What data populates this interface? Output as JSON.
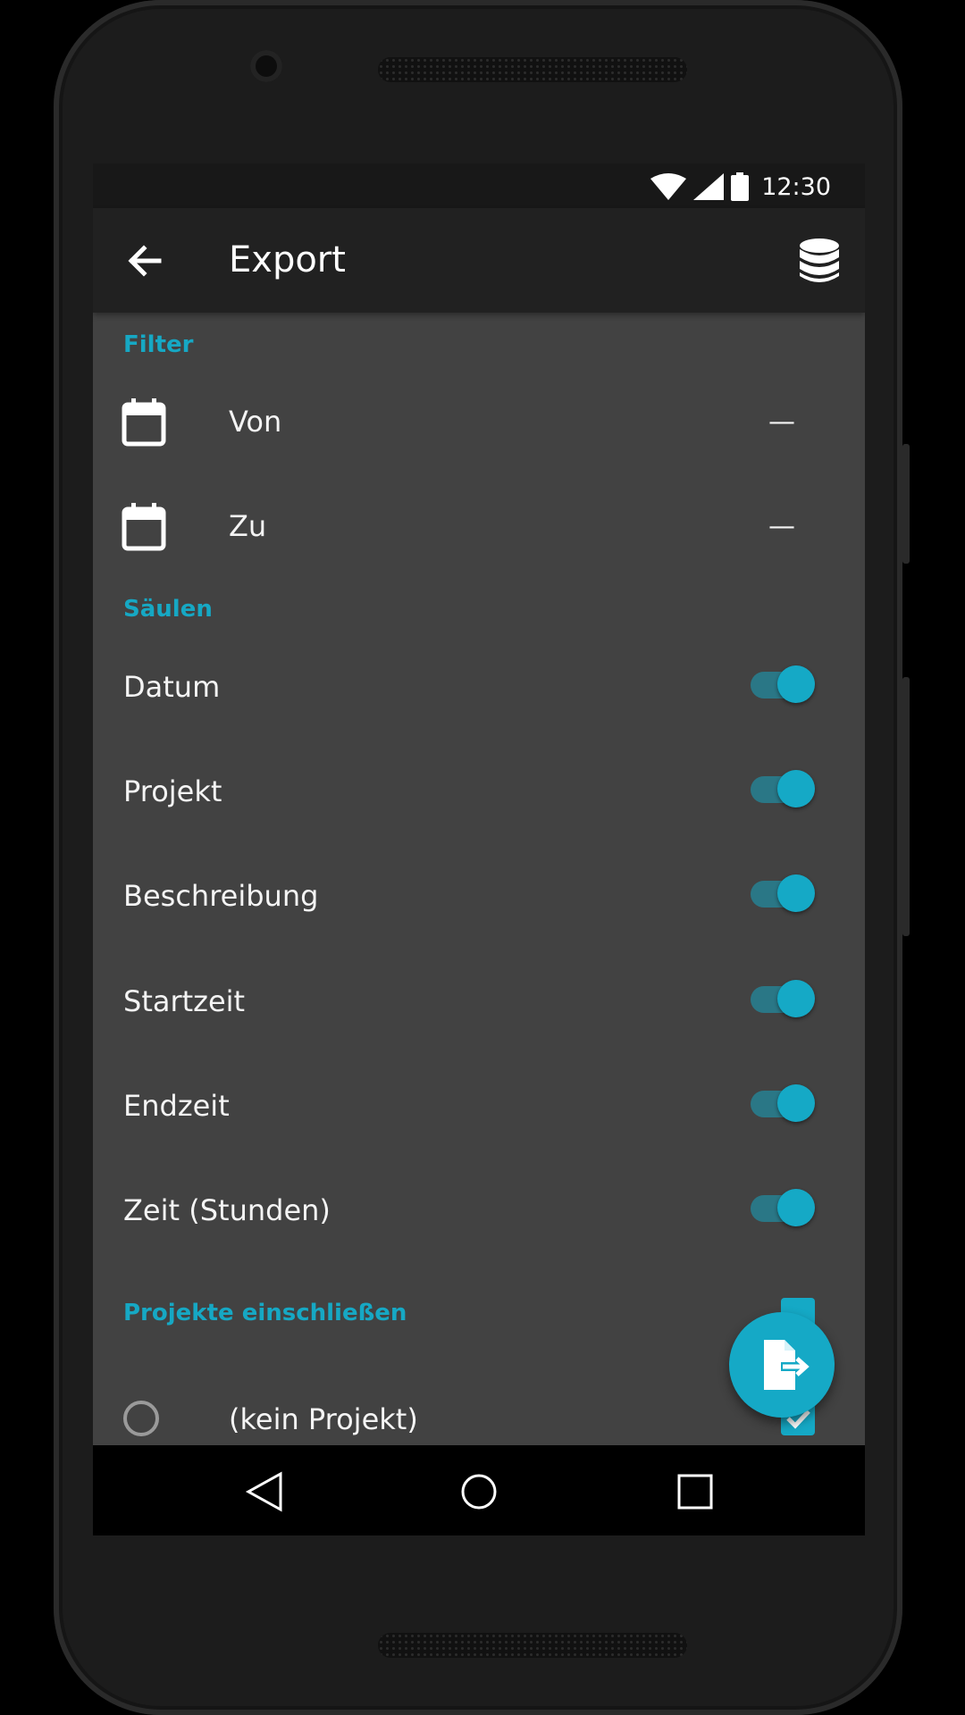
{
  "status_bar": {
    "time": "12:30"
  },
  "app_bar": {
    "title": "Export"
  },
  "filter": {
    "header": "Filter",
    "rows": [
      {
        "label": "Von",
        "value": "—"
      },
      {
        "label": "Zu",
        "value": "—"
      }
    ]
  },
  "columns": {
    "header": "Säulen",
    "items": [
      {
        "label": "Datum",
        "enabled": true
      },
      {
        "label": "Projekt",
        "enabled": true
      },
      {
        "label": "Beschreibung",
        "enabled": true
      },
      {
        "label": "Startzeit",
        "enabled": true
      },
      {
        "label": "Endzeit",
        "enabled": true
      },
      {
        "label": "Zeit (Stunden)",
        "enabled": true
      }
    ]
  },
  "projects": {
    "header": "Projekte einschließen",
    "items": [
      {
        "label": "(kein Projekt)",
        "checked": true
      }
    ]
  },
  "colors": {
    "accent": "#15a9c6",
    "background": "#424242",
    "app_bar": "#212121",
    "status_bar": "#181818"
  },
  "icons": {
    "back": "arrow-left-icon",
    "database": "database-icon",
    "calendar": "calendar-icon",
    "export": "file-export-icon",
    "nav_back": "triangle-back-icon",
    "nav_home": "circle-home-icon",
    "nav_recents": "square-recents-icon"
  }
}
